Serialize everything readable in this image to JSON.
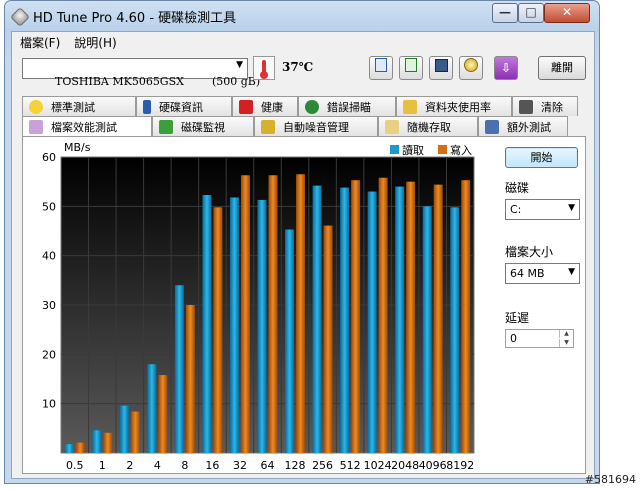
{
  "window": {
    "title": "HD Tune Pro 4.60 - 硬碟檢測工具",
    "minimize": "—",
    "maximize": "□",
    "close": "✕"
  },
  "menu": [
    "檔案(F)",
    "說明(H)"
  ],
  "toolbar": {
    "drive": "TOSHIBA MK5065GSX        (500 gB)",
    "temperature": "37℃",
    "buttons": [
      "copy-text-icon",
      "copy-screenshot-icon",
      "save-icon",
      "options-icon",
      "download-icon"
    ],
    "exit_label": "離開"
  },
  "tabs_row1": [
    {
      "label": "標準測試",
      "icon": "benchmark-icon"
    },
    {
      "label": "硬碟資訊",
      "icon": "info-icon"
    },
    {
      "label": "健康",
      "icon": "health-icon"
    },
    {
      "label": "錯誤掃瞄",
      "icon": "error-scan-icon"
    },
    {
      "label": "資料夾使用率",
      "icon": "folder-usage-icon"
    },
    {
      "label": "清除",
      "icon": "erase-icon"
    }
  ],
  "tabs_row2": [
    {
      "label": "檔案效能測試",
      "icon": "file-benchmark-icon",
      "active": true
    },
    {
      "label": "磁碟監視",
      "icon": "disk-monitor-icon"
    },
    {
      "label": "自動噪音管理",
      "icon": "aam-icon"
    },
    {
      "label": "隨機存取",
      "icon": "random-access-icon"
    },
    {
      "label": "額外測試",
      "icon": "extra-tests-icon"
    }
  ],
  "side": {
    "start_label": "開始",
    "drive_label": "磁碟",
    "drive_value": "C:",
    "filesize_label": "檔案大小",
    "filesize_value": "64 MB",
    "delay_label": "延遲",
    "delay_value": "0"
  },
  "chart_data": {
    "type": "bar",
    "ylabel": "MB/s",
    "ylim": [
      0,
      60
    ],
    "yticks": [
      10,
      20,
      30,
      40,
      50,
      60
    ],
    "categories": [
      "0.5",
      "1",
      "2",
      "4",
      "8",
      "16",
      "32",
      "64",
      "128",
      "256",
      "512",
      "1024",
      "2048",
      "4096",
      "8192"
    ],
    "series": [
      {
        "name": "讀取",
        "color": "#1a9bd0",
        "values": [
          1.8,
          4.6,
          9.6,
          18.0,
          34.0,
          52.3,
          51.8,
          51.3,
          45.3,
          54.2,
          53.8,
          53.0,
          54.0,
          50.0,
          49.8
        ]
      },
      {
        "name": "寫入",
        "color": "#d86c10",
        "values": [
          2.1,
          4.1,
          8.4,
          15.8,
          30.0,
          49.8,
          56.3,
          56.3,
          56.5,
          46.1,
          55.3,
          55.8,
          55.0,
          54.4,
          55.3
        ]
      }
    ],
    "legend_position": "top-right",
    "grid": true
  },
  "watermark": "#581694"
}
